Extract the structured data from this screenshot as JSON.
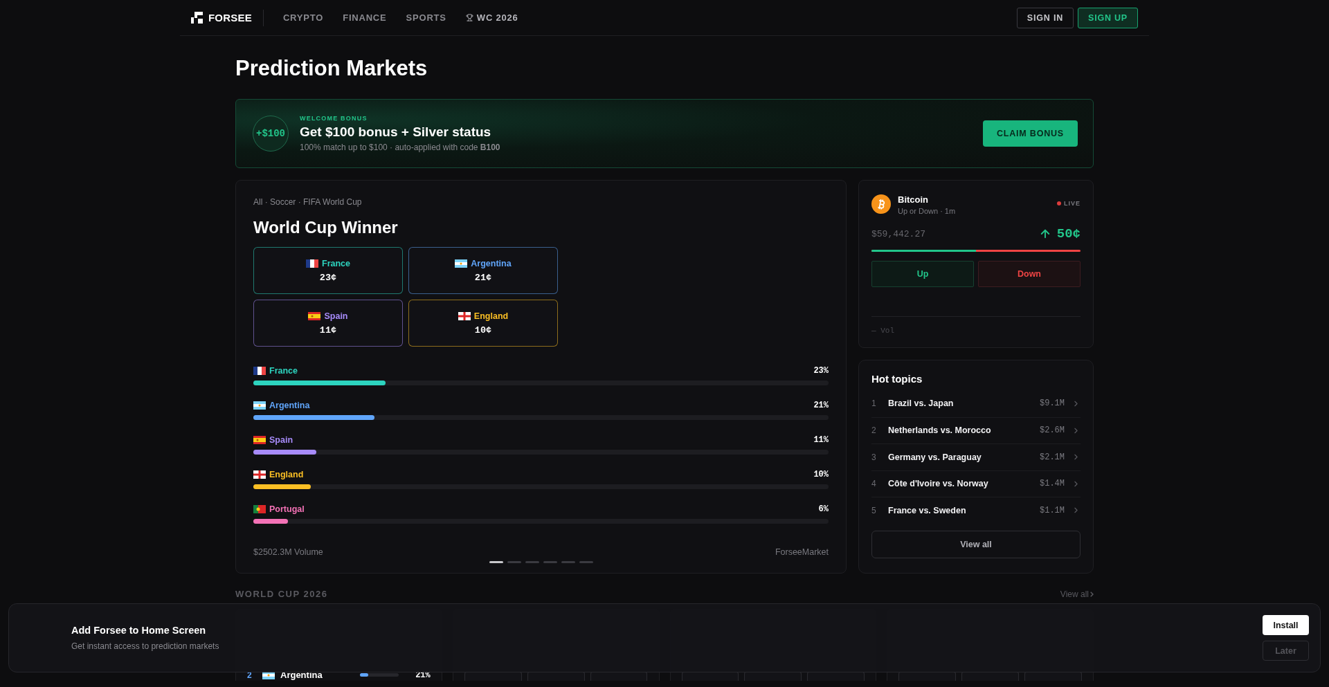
{
  "nav": {
    "logo": "FORSEE",
    "links": [
      {
        "label": "CRYPTO",
        "kind": "plain"
      },
      {
        "label": "FINANCE",
        "kind": "plain"
      },
      {
        "label": "SPORTS",
        "kind": "plain"
      },
      {
        "label": "WC 2026",
        "kind": "trophy"
      }
    ],
    "buttons": [
      {
        "label": "SIGN IN",
        "kind": "outline"
      },
      {
        "label": "SIGN UP",
        "kind": "primary"
      }
    ]
  },
  "page_title": "Prediction Markets",
  "bonus": {
    "badge": "+$100",
    "eyebrow": "WELCOME BONUS",
    "headline": "Get **$100 bonus** + Silver status",
    "subtext": "100% match up to $100 · auto-applied with code **B100**",
    "button": "CLAIM BONUS"
  },
  "market": {
    "breadcrumb": "All · Soccer · FIFA World Cup",
    "title": "World Cup Winner",
    "outcomes": [
      {
        "name": "France",
        "price": "23¢",
        "color": "#2dd4bf",
        "kind": "france"
      },
      {
        "name": "Argentina",
        "price": "21¢",
        "color": "#60a5fa",
        "kind": "argentina"
      },
      {
        "name": "Spain",
        "price": "11¢",
        "color": "#a78bfa",
        "kind": "spain"
      },
      {
        "name": "England",
        "price": "10¢",
        "color": "#fbbf24",
        "kind": "england"
      }
    ],
    "bars": [
      {
        "name": "France",
        "percent": "23%",
        "level": 0.23,
        "color": "#2dd4bf",
        "kind": "france"
      },
      {
        "name": "Argentina",
        "percent": "21%",
        "level": 0.21,
        "color": "#60a5fa",
        "kind": "argentina"
      },
      {
        "name": "Spain",
        "percent": "11%",
        "level": 0.11,
        "color": "#a78bfa",
        "kind": "spain"
      },
      {
        "name": "England",
        "percent": "10%",
        "level": 0.1,
        "color": "#fbbf24",
        "kind": "england"
      },
      {
        "name": "Portugal",
        "percent": "6%",
        "level": 0.06,
        "color": "#f472b6",
        "kind": "portugal"
      }
    ],
    "volume": "$2502.3M Volume",
    "source": "ForseeMarket",
    "pages": [
      {
        "selected": true
      },
      {
        "selected": false
      },
      {
        "selected": false
      },
      {
        "selected": false
      },
      {
        "selected": false
      },
      {
        "selected": false
      }
    ]
  },
  "crypto": {
    "name": "Bitcoin",
    "subtitle": "Up or Down · 1m",
    "status": "LIVE",
    "price": "$59,442.27",
    "change": "50¢",
    "level": 0.5,
    "buttons": [
      {
        "label": "Up",
        "kind": "up"
      },
      {
        "label": "Down",
        "kind": "down"
      }
    ],
    "volume": "— Vol"
  },
  "hot_topics": {
    "title": "Hot topics",
    "items": [
      {
        "rank": "1",
        "name": "Brazil vs. Japan",
        "volume": "$9.1M"
      },
      {
        "rank": "2",
        "name": "Netherlands vs. Morocco",
        "volume": "$2.6M"
      },
      {
        "rank": "3",
        "name": "Germany vs. Paraguay",
        "volume": "$2.1M"
      },
      {
        "rank": "4",
        "name": "Côte d'Ivoire vs. Norway",
        "volume": "$1.4M"
      },
      {
        "rank": "5",
        "name": "France vs. Sweden",
        "volume": "$1.1M"
      }
    ],
    "button": "View all"
  },
  "section": {
    "title": "WORLD CUP 2026",
    "link": "View all",
    "rows": [
      {
        "rank": "2",
        "name": "Argentina",
        "level": 0.21,
        "percent": "21%",
        "kind": "argentina"
      }
    ]
  },
  "install_prompt": {
    "title": "Add Forsee to Home Screen",
    "text": "Get instant access to prediction markets",
    "buttons": [
      {
        "label": "Install",
        "kind": "primary"
      },
      {
        "label": "Later",
        "kind": "secondary"
      }
    ]
  }
}
